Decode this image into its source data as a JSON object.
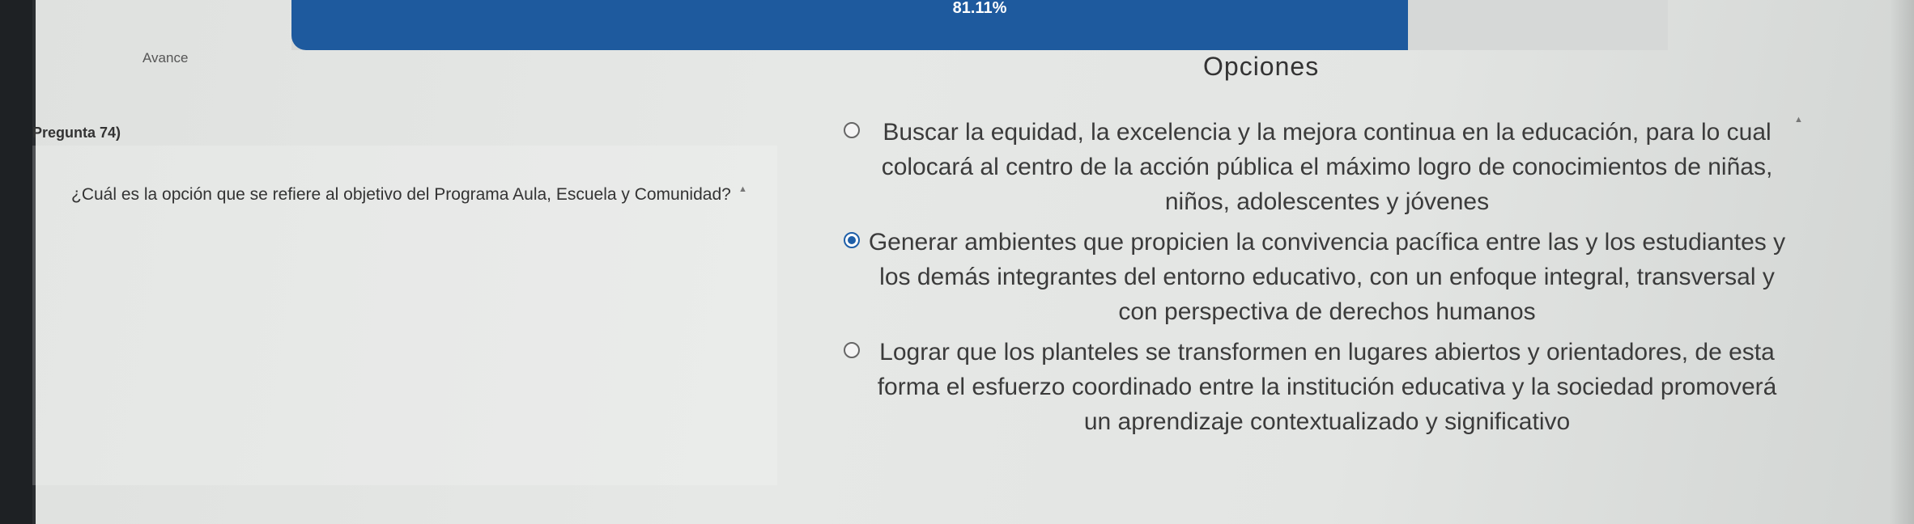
{
  "progress": {
    "label": "Avance",
    "percent_text": "81.11%",
    "fraction": 0.8111,
    "fill_color": "#1e5a9e"
  },
  "question": {
    "label": "Pregunta 74)",
    "text": "¿Cuál es la opción que se refiere al objetivo del Programa Aula, Escuela y Comunidad?"
  },
  "options": {
    "title": "Opciones",
    "items": [
      {
        "text": "Buscar la equidad, la excelencia y la mejora continua en la educación, para lo cual colocará al centro de la acción pública el máximo logro de conocimientos de niñas, niños, adolescentes y jóvenes",
        "selected": false
      },
      {
        "text": "Generar ambientes que propicien la convivencia pacífica entre las y los estudiantes y los demás integrantes del entorno educativo, con un enfoque integral, transversal y con perspectiva de derechos humanos",
        "selected": true
      },
      {
        "text": "Lograr que los planteles se transformen en lugares abiertos y orientadores, de esta forma el esfuerzo coordinado entre la institución educativa y la sociedad promoverá un aprendizaje contextualizado y significativo",
        "selected": false
      }
    ]
  },
  "icons": {
    "radio_unselected": "radio-empty-icon",
    "radio_selected": "radio-filled-icon",
    "caret": "caret-up-icon"
  }
}
